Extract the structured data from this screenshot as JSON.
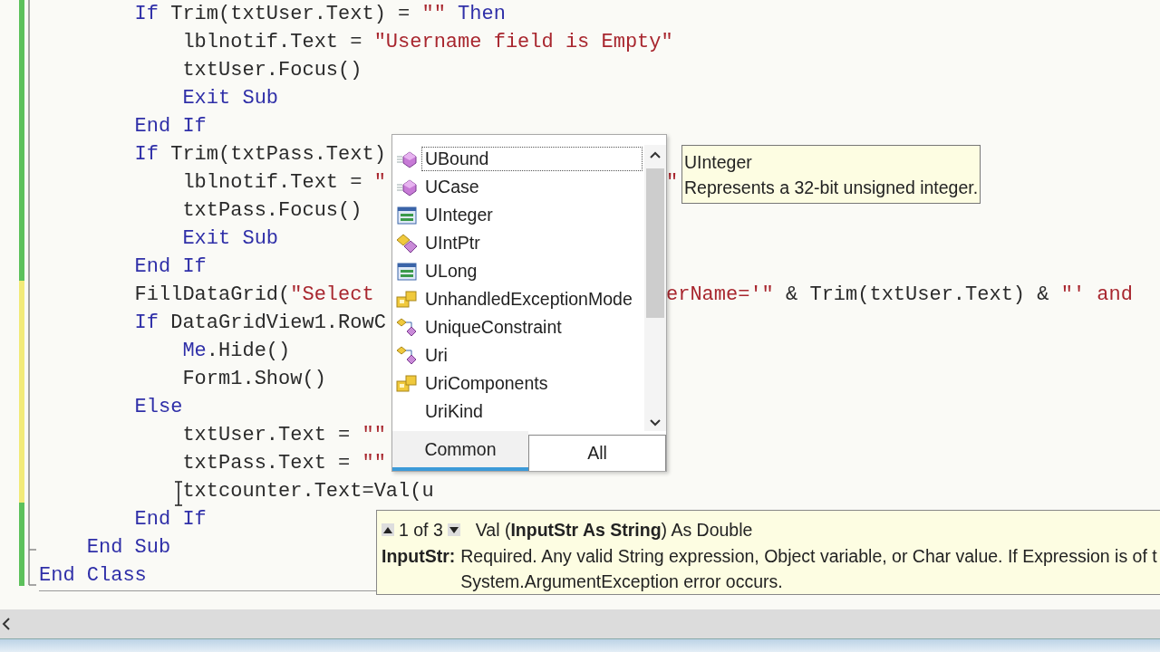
{
  "editor": {
    "lines": [
      {
        "tokens": [
          {
            "kind": "keyword",
            "text": "        If"
          },
          {
            "kind": "plain",
            "text": " Trim(txtUser.Text) = "
          },
          {
            "kind": "string",
            "text": "\"\""
          },
          {
            "kind": "keyword",
            "text": " Then"
          }
        ]
      },
      {
        "tokens": [
          {
            "kind": "plain",
            "text": "            lblnotif.Text = "
          },
          {
            "kind": "string",
            "text": "\"Username field is Empty\""
          }
        ]
      },
      {
        "tokens": [
          {
            "kind": "plain",
            "text": "            txtUser.Focus()"
          }
        ]
      },
      {
        "tokens": [
          {
            "kind": "keyword",
            "text": "            Exit Sub"
          }
        ]
      },
      {
        "tokens": [
          {
            "kind": "keyword",
            "text": "        End If"
          }
        ]
      },
      {
        "tokens": [
          {
            "kind": "keyword",
            "text": "        If"
          },
          {
            "kind": "plain",
            "text": " Trim(txtPass.Text)"
          }
        ]
      },
      {
        "tokens": [
          {
            "kind": "plain",
            "text": "            lblnotif.Text = "
          },
          {
            "kind": "string",
            "text": "\""
          }
        ],
        "tail": [
          {
            "kind": "string",
            "text": "\""
          }
        ]
      },
      {
        "tokens": [
          {
            "kind": "plain",
            "text": "            txtPass.Focus()"
          }
        ]
      },
      {
        "tokens": [
          {
            "kind": "keyword",
            "text": "            Exit Sub"
          }
        ]
      },
      {
        "tokens": [
          {
            "kind": "keyword",
            "text": "        End If"
          }
        ]
      },
      {
        "tokens": [
          {
            "kind": "plain",
            "text": "        FillDataGrid("
          },
          {
            "kind": "string",
            "text": "\"Select"
          }
        ],
        "tail": [
          {
            "kind": "string",
            "text": "erName='\""
          },
          {
            "kind": "plain",
            "text": " & Trim(txtUser.Text) & "
          },
          {
            "kind": "string",
            "text": "\"' and"
          }
        ]
      },
      {
        "tokens": [
          {
            "kind": "keyword",
            "text": "        If"
          },
          {
            "kind": "plain",
            "text": " DataGridView1.RowC"
          }
        ]
      },
      {
        "tokens": [
          {
            "kind": "keyword",
            "text": "            Me"
          },
          {
            "kind": "plain",
            "text": ".Hide()"
          }
        ]
      },
      {
        "tokens": [
          {
            "kind": "plain",
            "text": "            Form1.Show()"
          }
        ]
      },
      {
        "tokens": [
          {
            "kind": "keyword",
            "text": "        Else"
          }
        ]
      },
      {
        "tokens": [
          {
            "kind": "plain",
            "text": "            txtUser.Text = "
          },
          {
            "kind": "string",
            "text": "\"\""
          }
        ]
      },
      {
        "tokens": [
          {
            "kind": "plain",
            "text": "            txtPass.Text = "
          },
          {
            "kind": "string",
            "text": "\"\""
          }
        ]
      },
      {
        "tokens": [
          {
            "kind": "plain",
            "text": "            txtcounter.Text=Val(u"
          }
        ]
      },
      {
        "tokens": [
          {
            "kind": "keyword",
            "text": "        End If"
          }
        ]
      },
      {
        "tokens": [
          {
            "kind": "keyword",
            "text": "    End Sub"
          }
        ]
      },
      {
        "tokens": [
          {
            "kind": "keyword",
            "text": "End Class"
          }
        ]
      }
    ]
  },
  "completion": {
    "items": [
      {
        "label": "UBound",
        "kind": "method",
        "selected": true
      },
      {
        "label": "UCase",
        "kind": "method",
        "selected": false
      },
      {
        "label": "UInteger",
        "kind": "type",
        "selected": false
      },
      {
        "label": "UIntPtr",
        "kind": "struct",
        "selected": false
      },
      {
        "label": "ULong",
        "kind": "type",
        "selected": false
      },
      {
        "label": "UnhandledExceptionMode",
        "kind": "enum",
        "selected": false
      },
      {
        "label": "UniqueConstraint",
        "kind": "class",
        "selected": false
      },
      {
        "label": "Uri",
        "kind": "class",
        "selected": false
      },
      {
        "label": "UriComponents",
        "kind": "enum",
        "selected": false
      },
      {
        "label": "UriKind",
        "kind": "none",
        "selected": false
      }
    ],
    "tabs": [
      {
        "label": "Common",
        "selected": true
      },
      {
        "label": "All",
        "selected": false
      }
    ]
  },
  "quick_info": {
    "title": "UInteger",
    "description": "Represents a 32-bit unsigned integer."
  },
  "parameter_info": {
    "counter": "1 of 3",
    "signature": "Val (**InputStr As String**) As Double",
    "parameter": "InputStr:",
    "description": [
      "Required. Any valid String expression, Object variable, or Char value. If Expression is of t",
      "System.ArgumentException error occurs."
    ]
  }
}
